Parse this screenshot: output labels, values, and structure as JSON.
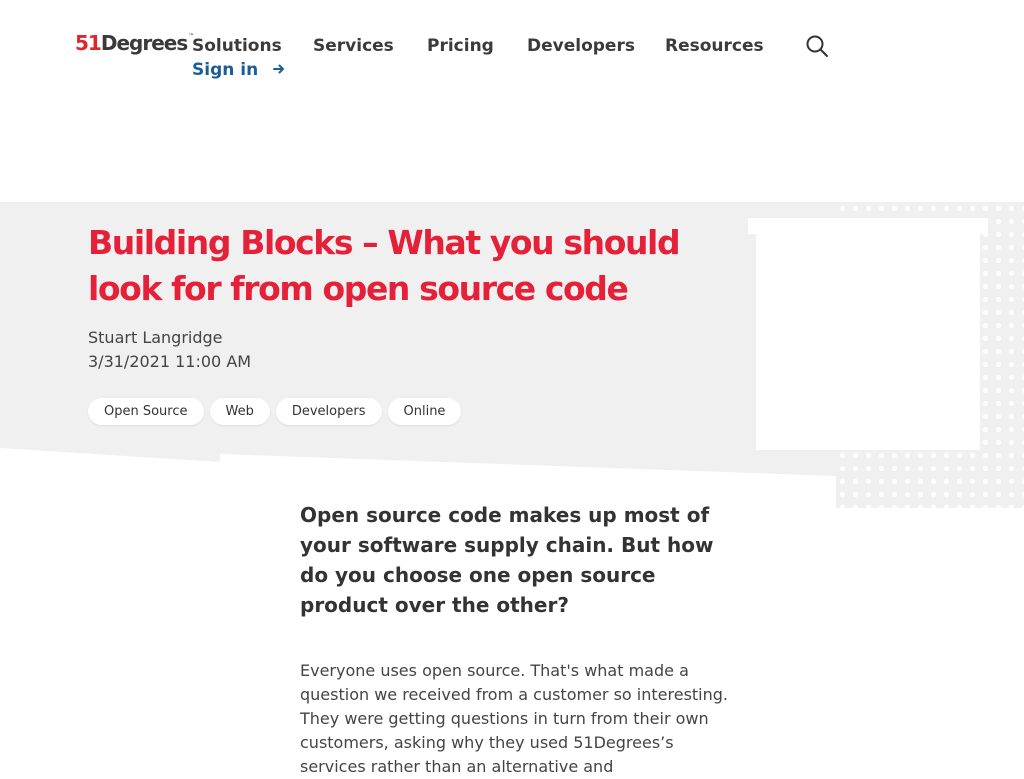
{
  "header": {
    "logo_num": "51",
    "logo_word": "Degrees",
    "logo_tm": "™",
    "nav": [
      "Solutions",
      "Services",
      "Pricing",
      "Developers",
      "Resources"
    ],
    "signin_label": "Sign in",
    "icons": {
      "search": "search-icon",
      "signin_arrow": "arrow-right-icon"
    }
  },
  "hero": {
    "title": "Building Blocks – What you should look for from open source code",
    "author": "Stuart Langridge",
    "date": "3/31/2021 11:00 AM",
    "tags": [
      "Open Source",
      "Web",
      "Developers",
      "Online"
    ]
  },
  "article": {
    "lead": "Open source code makes up most of your software supply chain. But how do you choose one open source product over the other?",
    "paragraph": "Everyone uses open source. That's what made a question we received from a customer so interesting. They were getting questions in turn from their own customers, asking why they used 51Degrees’s services rather than an alternative and"
  },
  "colors": {
    "brand_red": "#e5213a",
    "link_blue": "#1a5d99",
    "hero_bg": "#f0f0f0",
    "text": "#333333"
  }
}
